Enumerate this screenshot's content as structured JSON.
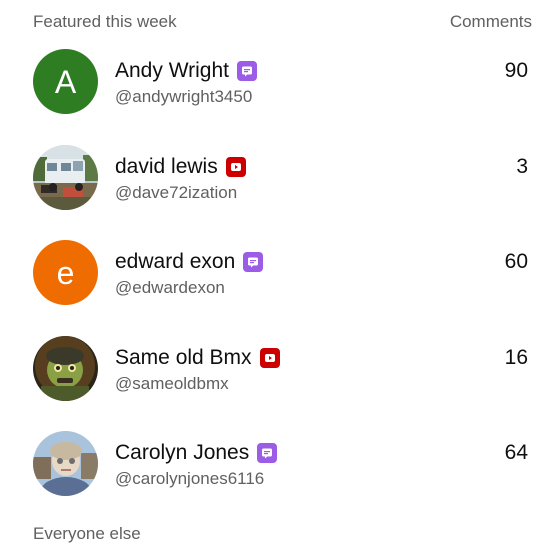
{
  "header": {
    "title": "Featured this week",
    "column_label": "Comments"
  },
  "colors": {
    "member_badge": "#9b5de5",
    "youtube_badge": "#cc0000",
    "avatar_green": "#2e7d22",
    "avatar_orange": "#ef6c00"
  },
  "rows": [
    {
      "avatar_letter": "A",
      "avatar_type": "letter",
      "name": "Andy Wright",
      "badge": "member-badge-icon",
      "handle": "@andywright3450",
      "comments": "90"
    },
    {
      "avatar_type": "photo",
      "avatar_icon": "van-photo-avatar",
      "name": "david lewis",
      "badge": "youtube-badge-icon",
      "handle": "@dave72ization",
      "comments": "3"
    },
    {
      "avatar_letter": "e",
      "avatar_type": "letter",
      "name": "edward exon",
      "badge": "member-badge-icon",
      "handle": "@edwardexon",
      "comments": "60"
    },
    {
      "avatar_type": "photo",
      "avatar_icon": "zombie-art-avatar",
      "name": "Same old Bmx",
      "badge": "youtube-badge-icon",
      "handle": "@sameoldbmx",
      "comments": "16"
    },
    {
      "avatar_type": "photo",
      "avatar_icon": "person-photo-avatar",
      "name": "Carolyn Jones",
      "badge": "member-badge-icon",
      "handle": "@carolynjones6116",
      "comments": "64"
    }
  ],
  "footer": {
    "title": "Everyone else"
  }
}
